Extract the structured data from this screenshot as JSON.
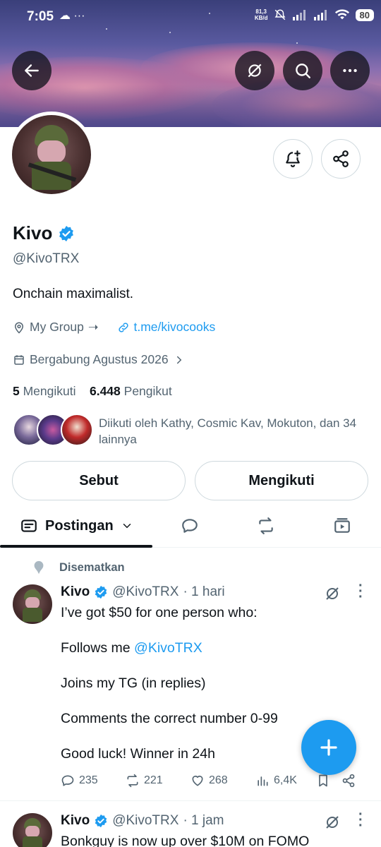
{
  "status_bar": {
    "time": "7:05",
    "net_speed": "81,3",
    "net_unit": "KB/d",
    "battery": "80"
  },
  "profile": {
    "name": "Kivo",
    "handle": "@KivoTRX",
    "bio": "Onchain maximalist.",
    "group_label": "My Group",
    "group_arrow": "➝",
    "website": "t.me/kivocooks",
    "joined": "Bergabung Agustus 2026",
    "following_count": "5",
    "following_label": "Mengikuti",
    "followers_count": "6.448",
    "followers_label": "Pengikut",
    "followed_by": "Diikuti oleh Kathy, Cosmic Kav, Mokuton, dan 34 lainnya"
  },
  "buttons": {
    "mention": "Sebut",
    "following": "Mengikuti"
  },
  "tabs": {
    "posts": "Postingan"
  },
  "pinned_label": "Disematkan",
  "post1": {
    "name": "Kivo",
    "handle": "@KivoTRX",
    "time": "· 1 hari",
    "line1": "I’ve got $50 for one person who:",
    "line2_prefix": "Follows me ",
    "line2_mention": "@KivoTRX",
    "line3": "Joins my TG (in replies)",
    "line4": "Comments the correct number 0-99",
    "line5": "Good luck! Winner in 24h",
    "replies": "235",
    "reposts": "221",
    "likes": "268",
    "views": "6,4K"
  },
  "post2": {
    "name": "Kivo",
    "handle": "@KivoTRX",
    "time": "· 1 jam",
    "line1": "Bonkguy is now up over $10M on FOMO"
  },
  "colors": {
    "accent": "#1d9bf0",
    "text": "#0f1419",
    "muted": "#536471"
  }
}
